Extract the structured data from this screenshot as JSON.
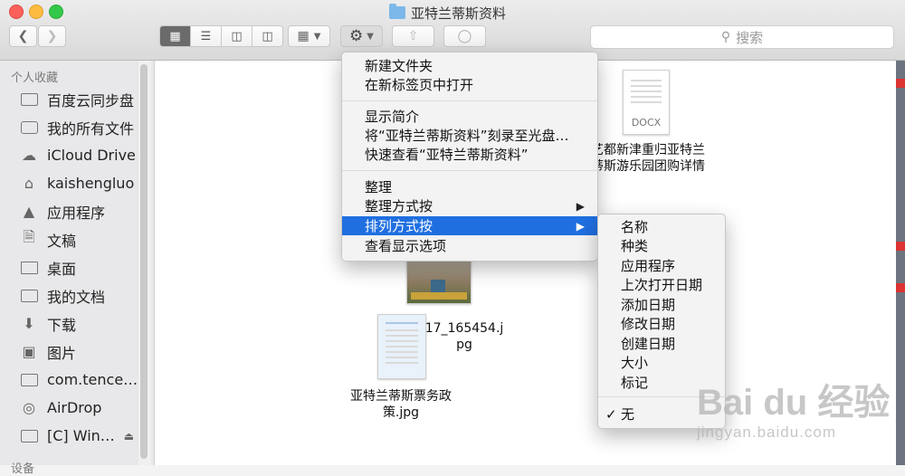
{
  "window": {
    "title": "亚特兰蒂斯资料"
  },
  "search": {
    "placeholder": "搜索"
  },
  "sidebar": {
    "section_favorites": "个人收藏",
    "section_devices": "设备",
    "items": [
      {
        "label": "百度云同步盘",
        "icon": "folder-icon"
      },
      {
        "label": "我的所有文件",
        "icon": "all-files-icon"
      },
      {
        "label": "iCloud Drive",
        "icon": "cloud-icon"
      },
      {
        "label": "kaishengluo",
        "icon": "home-icon"
      },
      {
        "label": "应用程序",
        "icon": "applications-icon"
      },
      {
        "label": "文稿",
        "icon": "document-icon"
      },
      {
        "label": "桌面",
        "icon": "desktop-icon"
      },
      {
        "label": "我的文档",
        "icon": "folder-icon"
      },
      {
        "label": "下载",
        "icon": "download-icon"
      },
      {
        "label": "图片",
        "icon": "camera-icon"
      },
      {
        "label": "com.tence…",
        "icon": "folder-icon"
      },
      {
        "label": "AirDrop",
        "icon": "airdrop-icon"
      },
      {
        "label": "[C] Win…",
        "icon": "folder-icon"
      }
    ]
  },
  "files": {
    "docx_badge": "DOCX",
    "docx_name_line1": "艺都新津重归亚特兰",
    "docx_name_line2": "蒂斯游乐园团购详情",
    "jpg1_name_line1": "17_165454.j",
    "jpg1_name_line2": "pg",
    "jpg2_name_line1": "亚特兰蒂斯票务政",
    "jpg2_name_line2": "策.jpg"
  },
  "context_menu": {
    "items": [
      "新建文件夹",
      "在新标签页中打开",
      "显示简介",
      "将“亚特兰蒂斯资料”刻录至光盘…",
      "快速查看“亚特兰蒂斯资料”",
      "整理",
      "整理方式按",
      "排列方式按",
      "查看显示选项"
    ]
  },
  "submenu": {
    "items": [
      "名称",
      "种类",
      "应用程序",
      "上次打开日期",
      "添加日期",
      "修改日期",
      "创建日期",
      "大小",
      "标记"
    ],
    "none_label": "无",
    "check": "✓"
  },
  "watermark": {
    "brand": "Bai du 经验",
    "url": "jingyan.baidu.com"
  }
}
